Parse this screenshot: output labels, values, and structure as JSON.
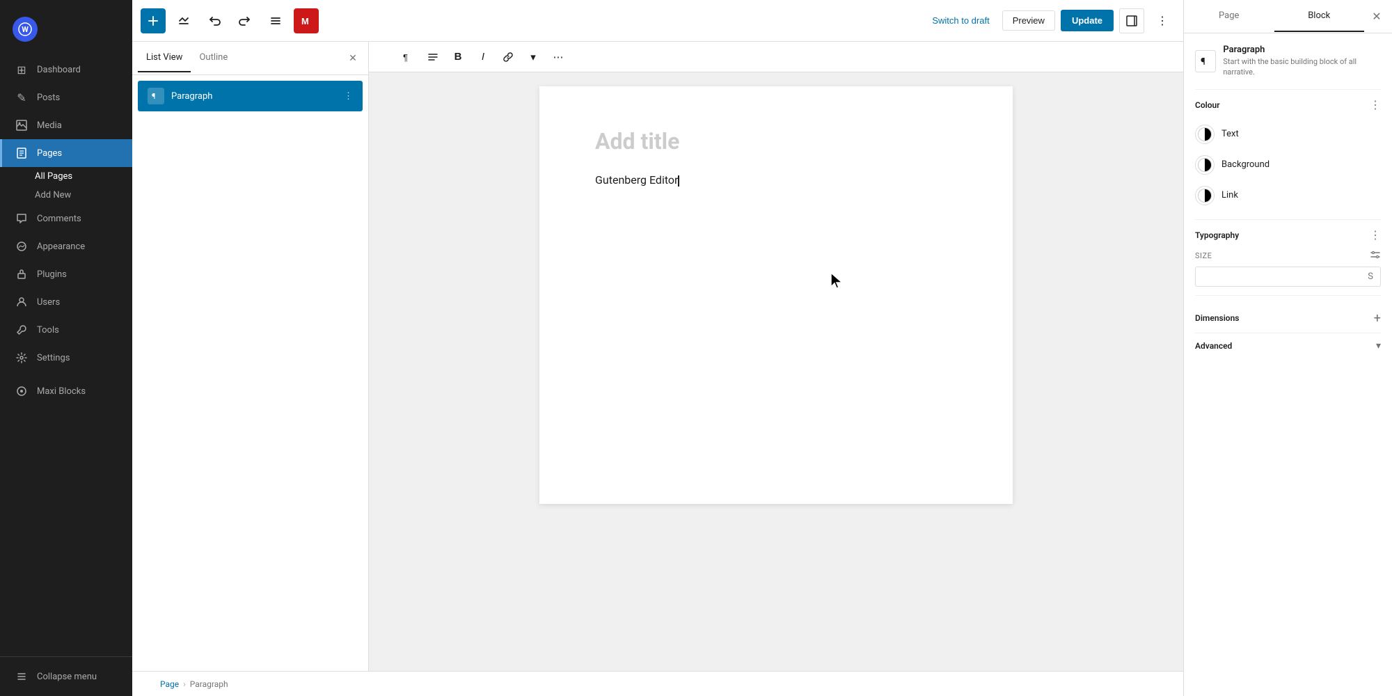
{
  "sidebar": {
    "logo": "W",
    "nav_items": [
      {
        "id": "dashboard",
        "label": "Dashboard",
        "icon": "⊞"
      },
      {
        "id": "posts",
        "label": "Posts",
        "icon": "✎"
      },
      {
        "id": "media",
        "label": "Media",
        "icon": "⬜"
      },
      {
        "id": "pages",
        "label": "Pages",
        "icon": "□",
        "active": true
      },
      {
        "id": "comments",
        "label": "Comments",
        "icon": "💬"
      },
      {
        "id": "appearance",
        "label": "Appearance",
        "icon": "🎨"
      },
      {
        "id": "plugins",
        "label": "Plugins",
        "icon": "🔌"
      },
      {
        "id": "users",
        "label": "Users",
        "icon": "👤"
      },
      {
        "id": "tools",
        "label": "Tools",
        "icon": "🔧"
      },
      {
        "id": "settings",
        "label": "Settings",
        "icon": "⚙"
      }
    ],
    "sub_items": [
      {
        "id": "all-pages",
        "label": "All Pages",
        "active": true
      },
      {
        "id": "add-new",
        "label": "Add New"
      }
    ],
    "maxi_blocks": "Maxi Blocks",
    "collapse": "Collapse menu"
  },
  "toolbar": {
    "switch_draft": "Switch to draft",
    "preview": "Preview",
    "update": "Update"
  },
  "list_view": {
    "tab_list_view": "List View",
    "tab_outline": "Outline",
    "block_item": "Paragraph"
  },
  "editor": {
    "title_placeholder": "Add title",
    "content": "Gutenberg Editor"
  },
  "breadcrumb": {
    "page": "Page",
    "separator": "›",
    "current": "Paragraph"
  },
  "format_toolbar": {
    "paragraph_icon": "¶",
    "align_icon": "≡",
    "bold": "B",
    "italic": "I",
    "link": "🔗",
    "dropdown": "▾",
    "more": "⋯"
  },
  "right_sidebar": {
    "tab_page": "Page",
    "tab_block": "Block",
    "block_name": "Paragraph",
    "block_desc": "Start with the basic building block of all narrative.",
    "colour_section": {
      "title": "Colour",
      "items": [
        {
          "id": "text",
          "label": "Text"
        },
        {
          "id": "background",
          "label": "Background"
        },
        {
          "id": "link",
          "label": "Link"
        }
      ]
    },
    "typography_section": {
      "title": "Typography",
      "size_label": "SIZE",
      "size_placeholder": "",
      "size_unit": "S"
    },
    "dimensions_section": {
      "title": "Dimensions"
    },
    "advanced_section": {
      "title": "Advanced"
    }
  }
}
